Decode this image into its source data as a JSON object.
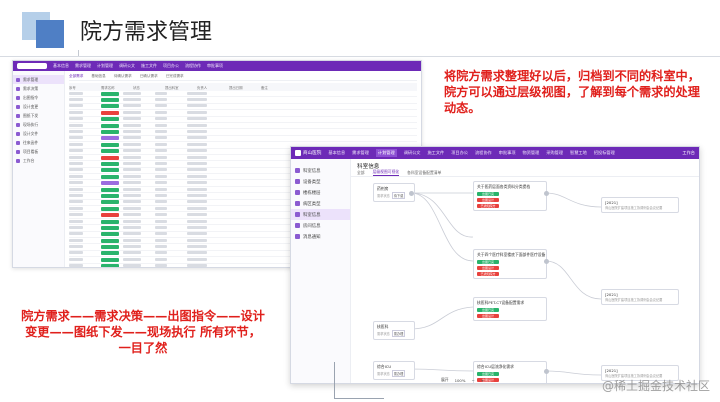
{
  "slide": {
    "title": "院方需求管理",
    "annotation_right": "将院方需求整理好以后，归档到不同的科室中，院方可以通过层级视图，了解到每个需求的处理动态。",
    "annotation_left": "院方需求——需求决策——出图指令——设计变更——图纸下发——现场执行 所有环节，一目了然",
    "watermark": "@稀土掘金技术社区"
  },
  "window_back": {
    "nav": [
      "基本信息",
      "需求管理",
      "计划管理",
      "调研公文",
      "施工文件",
      "项目办公",
      "流程协作",
      "审批事项"
    ],
    "sidebar": [
      "需求管理",
      "需求决策",
      "出图指令",
      "设计变更",
      "图纸下发",
      "现场执行",
      "设计文件",
      "往来函件",
      "项目看板",
      "工作台"
    ],
    "tabs": [
      "全部需求",
      "基础信息",
      "待确认需求",
      "已确认需求",
      "已完成需求"
    ],
    "headers": [
      "序号",
      "需求名称",
      "状态",
      "提出科室",
      "负责人",
      "提出日期",
      "备注"
    ],
    "rows": [
      {
        "status": "已确认",
        "color": "green"
      },
      {
        "status": "已确认",
        "color": "green"
      },
      {
        "status": "已确认",
        "color": "green"
      },
      {
        "status": "未处理",
        "color": "red"
      },
      {
        "status": "已确认",
        "color": "green"
      },
      {
        "status": "已确认",
        "color": "green"
      },
      {
        "status": "已确认",
        "color": "green"
      },
      {
        "status": "处理中",
        "color": "purple"
      },
      {
        "status": "已确认",
        "color": "green"
      },
      {
        "status": "已确认",
        "color": "green"
      },
      {
        "status": "未处理",
        "color": "red"
      },
      {
        "status": "已确认",
        "color": "green"
      },
      {
        "status": "已确认",
        "color": "green"
      },
      {
        "status": "已确认",
        "color": "green"
      },
      {
        "status": "处理中",
        "color": "purple"
      },
      {
        "status": "已确认",
        "color": "green"
      },
      {
        "status": "已确认",
        "color": "green"
      },
      {
        "status": "已确认",
        "color": "green"
      },
      {
        "status": "已确认",
        "color": "green"
      },
      {
        "status": "未处理",
        "color": "red"
      },
      {
        "status": "已确认",
        "color": "green"
      },
      {
        "status": "已确认",
        "color": "green"
      },
      {
        "status": "已确认",
        "color": "green"
      },
      {
        "status": "已确认",
        "color": "green"
      },
      {
        "status": "已确认",
        "color": "green"
      },
      {
        "status": "已确认",
        "color": "green"
      },
      {
        "status": "已确认",
        "color": "green"
      },
      {
        "status": "已确认",
        "color": "green"
      }
    ]
  },
  "window_front": {
    "app_name": "商山医院",
    "nav": [
      "基本信息",
      "需求管理",
      "计划管理",
      "调研公文",
      "施工文件",
      "项目办公",
      "流程协作",
      "审批事项",
      "物资管理",
      "采购管理",
      "智慧工地",
      "招投标管理",
      "档案管理",
      "财务管理",
      "安全管理"
    ],
    "nav_active_index": 2,
    "work_label": "工作台",
    "sidebar": [
      "科室信息",
      "设备类型",
      "楼栋楼层",
      "病区类型",
      "科室信息",
      "房间信息",
      "消息通知"
    ],
    "sidebar_active_index": 4,
    "page_title": "科室信息",
    "tabs": [
      "全部",
      "层级视图可视化",
      "各科室设备配置清单"
    ],
    "tabs_active_index": 1,
    "nodes": {
      "dept1": {
        "title": "药剂房",
        "sub": "需求状态",
        "pill": "待下载"
      },
      "dept2": {
        "title": "核医科",
        "sub": "需求状态",
        "pill": "需办理"
      },
      "dept3": {
        "title": "综合ICU",
        "sub": "需求状态",
        "pill": "需办理"
      },
      "req1": {
        "title": "关于医药层面各类资料分类提档",
        "b1": "出图已完",
        "b2": "出图设计",
        "b3": "已通知院方"
      },
      "req2": {
        "title": "关于四个医疗科室楼底下面部件医疗设备",
        "b1": "出图已完",
        "b2": "出图设计",
        "b3": "已通知院方"
      },
      "req3": {
        "title": "核医科PET-CT设备配置需求",
        "b1": "出图已完",
        "b2": "出图设计"
      },
      "req4": {
        "title": "综合ICU层流净化需求",
        "b1": "出图已完",
        "b2": "出图设计"
      },
      "dec1": {
        "title": "[2021]",
        "sub": "商山医院扩建项目施工协调例会会议纪要"
      },
      "dec2": {
        "title": "[2021]",
        "sub": "商山医院扩建项目施工协调例会会议纪要"
      },
      "dec3": {
        "title": "[2021]",
        "sub": "商山医院扩建项目施工协调例会会议纪要"
      }
    },
    "zoom": {
      "label": "展开",
      "value": "100%"
    }
  }
}
